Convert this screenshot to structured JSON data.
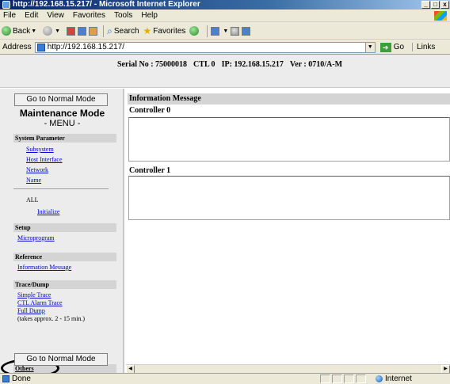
{
  "window": {
    "title": "http://192.168.15.217/ - Microsoft Internet Explorer",
    "controls": [
      "_",
      "□",
      "x"
    ]
  },
  "menubar": [
    "File",
    "Edit",
    "View",
    "Favorites",
    "Tools",
    "Help"
  ],
  "toolbar": {
    "back": "Back",
    "search": "Search",
    "favorites": "Favorites"
  },
  "address": {
    "label": "Address",
    "url": "http://192.168.15.217/",
    "go": "Go",
    "links": "Links"
  },
  "device_header": {
    "serial": "Serial No : 75000018",
    "ctl": "CTL 0",
    "ip": "IP: 192.168.15.217",
    "ver": "Ver : 0710/A-M"
  },
  "sidebar": {
    "normal_mode_button": "Go to Normal Mode",
    "mode_title": "Maintenance Mode",
    "menu_label": "- MENU -",
    "system_parameter": {
      "header": "System Parameter",
      "items": [
        "Subsystem",
        "Host Interface",
        "Network",
        "Name"
      ]
    },
    "all_label": "ALL",
    "initialize": "Initialize",
    "setup": {
      "header": "Setup",
      "items": [
        "Microprogram"
      ]
    },
    "reference": {
      "header": "Reference",
      "items": [
        "Information Message"
      ]
    },
    "trace_dump": {
      "header": "Trace/Dump",
      "items": [
        "Simple Trace",
        "CTL Alarm Trace",
        "Full Dump"
      ],
      "note": "(takes approx. 2 - 15 min.)"
    },
    "others_header": "Others",
    "normal_mode_button_bottom": "Go to Normal Mode"
  },
  "main": {
    "header": "Information Message",
    "controllers": [
      "Controller 0",
      "Controller 1"
    ]
  },
  "statusbar": {
    "status": "Done",
    "zone": "Internet"
  }
}
